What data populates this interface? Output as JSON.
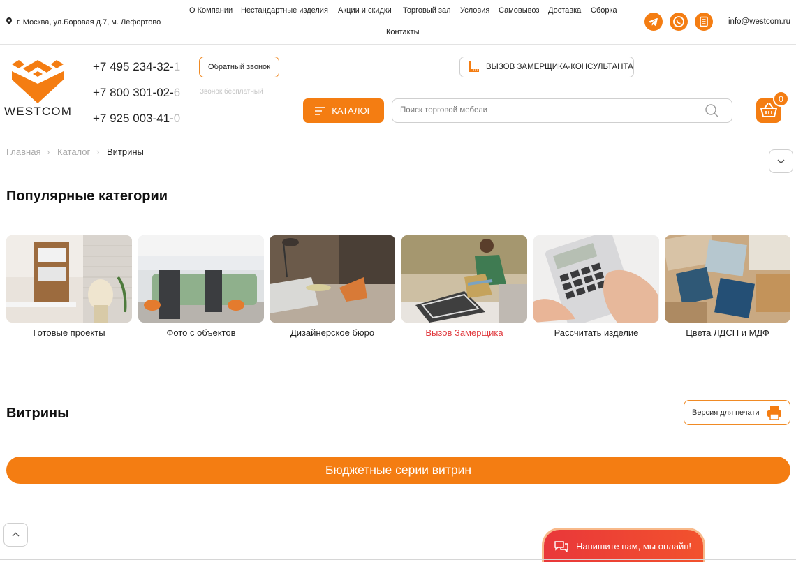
{
  "topbar": {
    "address": "г. Москва, ул.Боровая д.7, м. Лефортово",
    "nav": [
      "О Компании",
      "Нестандартные изделия",
      "Акции и скидки",
      "Торговый зал",
      "Условия",
      "Самовывоз",
      "Доставка",
      "Сборка",
      "Контакты"
    ],
    "social_icons": [
      "telegram-icon",
      "whatsapp-icon",
      "catalog-book-icon"
    ],
    "email": "info@westcom.ru"
  },
  "header": {
    "logo_text": "WESTCOM",
    "phones": [
      {
        "main": "+7 495 234-32-",
        "faded": "1"
      },
      {
        "main": "+7 800 301-02-",
        "faded": "6"
      },
      {
        "main": "+7 925 003-41-",
        "faded": "0"
      }
    ],
    "callback_label": "Обратный звонок",
    "free_call_note": "Звонок бесплатный",
    "measure_label": "ВЫЗОВ ЗАМЕРЩИКА-КОНСУЛЬТАНТА",
    "catalog_label": "КАТАЛОГ",
    "search_placeholder": "Поиск торговой мебели",
    "cart_count": "0",
    "accent_color": "#f47d12"
  },
  "breadcrumb": [
    "Главная",
    "Каталог",
    "Витрины"
  ],
  "popular": {
    "title": "Популярные категории",
    "items": [
      {
        "label": "Готовые проекты",
        "highlight": false
      },
      {
        "label": "Фото с объектов",
        "highlight": false
      },
      {
        "label": "Дизайнерское бюро",
        "highlight": false
      },
      {
        "label": "Вызов Замерщика",
        "highlight": true
      },
      {
        "label": "Рассчитать изделие",
        "highlight": false
      },
      {
        "label": "Цвета ЛДСП и МДФ",
        "highlight": false
      }
    ]
  },
  "section": {
    "title": "Витрины",
    "print_label": "Версия для печати",
    "budget_label": "Бюджетные серии витрин"
  },
  "chat": {
    "label": "Напишите нам, мы онлайн!"
  }
}
